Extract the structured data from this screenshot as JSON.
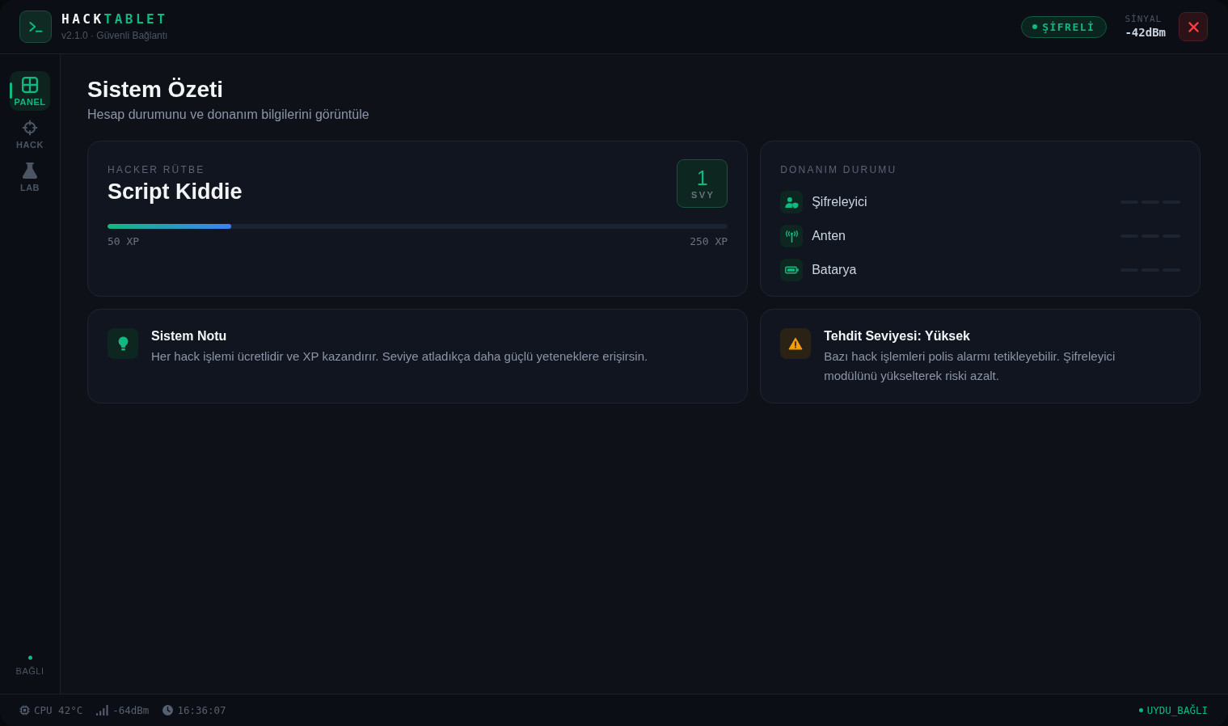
{
  "header": {
    "logo": {
      "part_1": "HACK",
      "part_2": "TABLET"
    },
    "subtitle": "v2.1.0 · Güvenli Bağlantı",
    "badge": "ŞİFRELİ",
    "signal": {
      "label": "SİNYAL",
      "reading": "-42dBm"
    }
  },
  "sidebar": {
    "items": [
      {
        "kind": "grid",
        "label": "PANEL",
        "selected": true
      },
      {
        "kind": "crosshair",
        "label": "HACK",
        "selected": false
      },
      {
        "kind": "flask",
        "label": "LAB",
        "selected": false
      }
    ],
    "connection": {
      "label": "BAĞLI",
      "connected": true
    }
  },
  "page": {
    "title": "Sistem Özeti",
    "subtitle": "Hesap durumunu ve donanım bilgilerini görüntüle"
  },
  "rank_card": {
    "label": "HACKER RÜTBE",
    "rank": "Script Kiddie",
    "level_badge": {
      "value": "1",
      "label": "SVY"
    },
    "progress": {
      "level": 0.2,
      "start_label": "50 XP",
      "end_label": "250 XP"
    }
  },
  "hardware_card": {
    "title": "DONANIM DURUMU",
    "items": [
      {
        "kind": "user-shield",
        "name": "Şifreleyici",
        "segments": [
          {
            "on": false
          },
          {
            "on": false
          },
          {
            "on": false
          }
        ]
      },
      {
        "kind": "antenna",
        "name": "Anten",
        "segments": [
          {
            "on": false
          },
          {
            "on": false
          },
          {
            "on": false
          }
        ]
      },
      {
        "kind": "battery",
        "name": "Batarya",
        "segments": [
          {
            "on": false
          },
          {
            "on": false
          },
          {
            "on": false
          }
        ]
      }
    ]
  },
  "notes": [
    {
      "kind": "info",
      "title": "Sistem Notu",
      "text": "Her hack işlemi ücretlidir ve XP kazandırır. Seviye atladıkça daha güçlü yeteneklere erişirsin."
    },
    {
      "kind": "warning",
      "title": "Tehdit Seviyesi: Yüksek",
      "text": "Bazı hack işlemleri polis alarmı tetikleyebilir. Şifreleyici modülünü yükselterek riski azalt."
    }
  ],
  "status_bar": {
    "items": [
      {
        "kind": "cpu",
        "text": "CPU 42°C"
      },
      {
        "kind": "signal",
        "text": "-64dBm"
      },
      {
        "kind": "clock",
        "text": "16:36:07"
      }
    ],
    "connection": {
      "label": "UYDU_BAĞLI",
      "connected": true
    }
  }
}
